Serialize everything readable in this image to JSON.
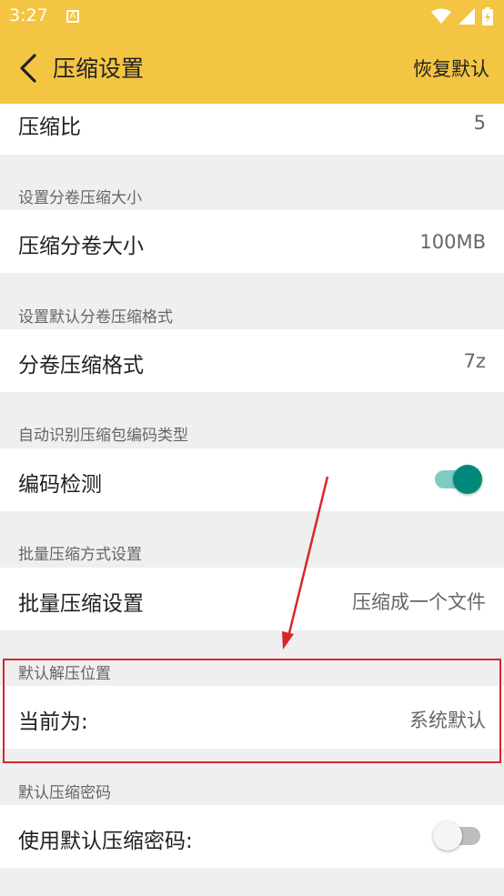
{
  "status_bar": {
    "time": "3:27",
    "notification_icon_letter": "A",
    "icons": [
      "wifi-icon",
      "signal-icon",
      "battery-icon"
    ]
  },
  "toolbar": {
    "title": "压缩设置",
    "restore_label": "恢复默认",
    "back_icon": "chevron-left-icon"
  },
  "settings": {
    "compression_ratio": {
      "label": "压缩比",
      "value": "5"
    },
    "split_size_section": "设置分卷压缩大小",
    "split_size": {
      "label": "压缩分卷大小",
      "value": "100MB"
    },
    "split_format_section": "设置默认分卷压缩格式",
    "split_format": {
      "label": "分卷压缩格式",
      "value": "7z"
    },
    "encoding_section": "自动识别压缩包编码类型",
    "encoding_detect": {
      "label": "编码检测",
      "enabled": true
    },
    "batch_section": "批量压缩方式设置",
    "batch_mode": {
      "label": "批量压缩设置",
      "value": "压缩成一个文件"
    },
    "extract_location_section": "默认解压位置",
    "extract_location": {
      "label": "当前为:",
      "value": "系统默认"
    },
    "password_section": "默认压缩密码",
    "use_password": {
      "label": "使用默认压缩密码:",
      "enabled": false
    }
  },
  "colors": {
    "toolbar_bg": "#f3c542",
    "toggle_on_thumb": "#00897b",
    "toggle_on_track": "#80cbc4",
    "toggle_off_thumb": "#f5f5f5",
    "toggle_off_track": "#bdbdbd",
    "annotation_red": "#d7262c"
  }
}
